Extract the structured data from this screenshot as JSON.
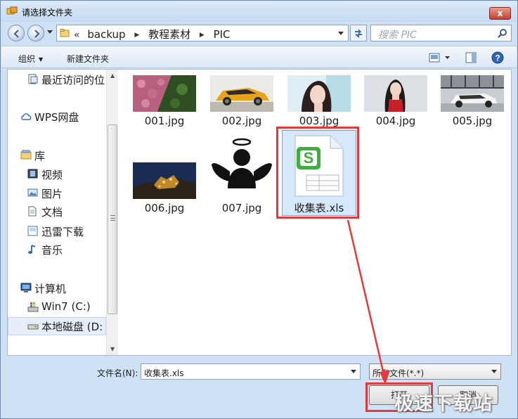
{
  "window": {
    "title": "请选择文件夹",
    "close_glyph": "x"
  },
  "address": {
    "overflow": "«",
    "crumbs": [
      "backup",
      "教程素材",
      "PIC"
    ]
  },
  "search": {
    "placeholder": "搜索 PIC"
  },
  "toolbar": {
    "organize": "组织",
    "new_folder": "新建文件夹"
  },
  "sidebar": {
    "items": [
      {
        "label": "最近访问的位",
        "icon": "recent-places-icon"
      },
      {
        "label": "WPS网盘",
        "icon": "cloud-icon"
      },
      {
        "label": "库",
        "icon": "library-icon"
      },
      {
        "label": "视频",
        "icon": "video-icon"
      },
      {
        "label": "图片",
        "icon": "picture-icon"
      },
      {
        "label": "文档",
        "icon": "document-icon"
      },
      {
        "label": "迅雷下载",
        "icon": "download-icon"
      },
      {
        "label": "音乐",
        "icon": "music-icon"
      },
      {
        "label": "计算机",
        "icon": "computer-icon"
      },
      {
        "label": "Win7 (C:)",
        "icon": "drive-c-icon"
      },
      {
        "label": "本地磁盘 (D:",
        "icon": "drive-d-icon"
      }
    ]
  },
  "files": [
    {
      "name": "001.jpg"
    },
    {
      "name": "002.jpg"
    },
    {
      "name": "003.jpg"
    },
    {
      "name": "004.jpg"
    },
    {
      "name": "005.jpg"
    },
    {
      "name": "006.jpg"
    },
    {
      "name": "007.jpg"
    },
    {
      "name": "收集表.xls",
      "selected": true
    }
  ],
  "footer": {
    "filename_label": "文件名(N):",
    "filename_value": "收集表.xls",
    "filter_value": "所有文件(*.*)",
    "open_label": "打开",
    "cancel_label": "取消"
  },
  "watermark": "极速下载站",
  "colors": {
    "highlight": "#e23a3a",
    "selection": "#d6e8fb",
    "chrome": "#cfe1f5"
  }
}
